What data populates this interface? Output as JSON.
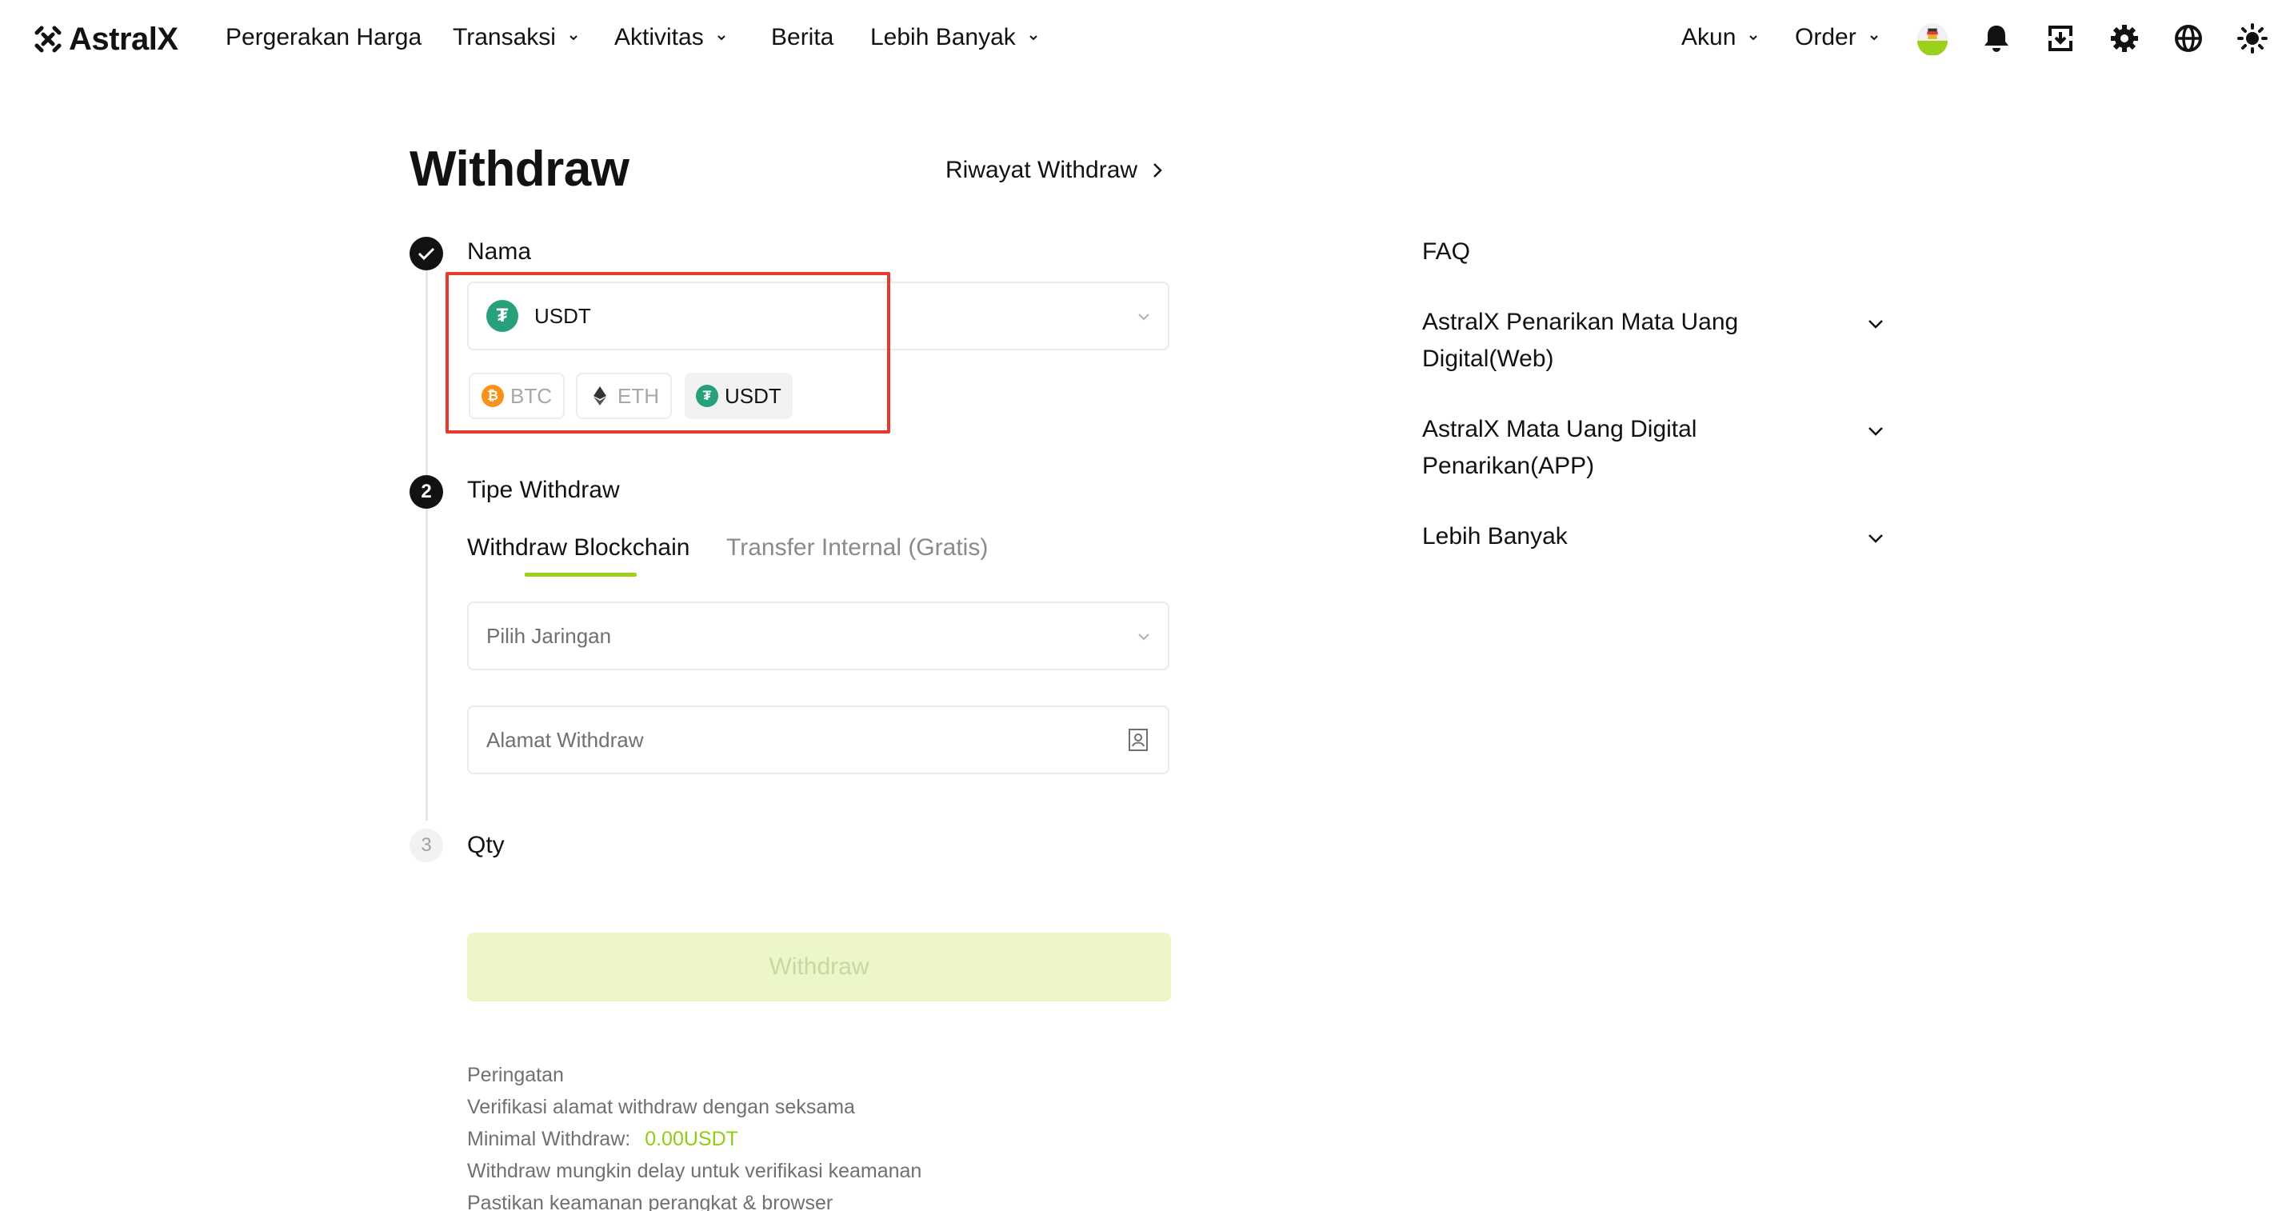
{
  "nav": {
    "logo_text": "AstralX",
    "items": [
      {
        "label": "Pergerakan Harga",
        "has_caret": false
      },
      {
        "label": "Transaksi",
        "has_caret": true
      },
      {
        "label": "Aktivitas",
        "has_caret": true
      },
      {
        "label": "Berita",
        "has_caret": false
      },
      {
        "label": "Lebih Banyak",
        "has_caret": true
      }
    ],
    "right": [
      {
        "label": "Akun",
        "has_caret": true
      },
      {
        "label": "Order",
        "has_caret": true
      }
    ],
    "icons": [
      "avatar-icon",
      "bell-icon",
      "download-app-icon",
      "gear-icon",
      "globe-icon",
      "theme-sun-icon"
    ]
  },
  "page": {
    "title": "Withdraw",
    "history_link": "Riwayat Withdraw"
  },
  "steps": [
    {
      "number": "",
      "label": "Nama",
      "state": "done"
    },
    {
      "number": "2",
      "label": "Tipe Withdraw",
      "state": "active"
    },
    {
      "number": "3",
      "label": "Qty",
      "state": "pending"
    }
  ],
  "coin_select": {
    "value": "USDT",
    "icon": "tether-icon",
    "quick_picks": [
      {
        "label": "BTC",
        "icon": "bitcoin-icon",
        "color": "#f7931a",
        "selected": false
      },
      {
        "label": "ETH",
        "icon": "ethereum-icon",
        "color": "#333333",
        "selected": false
      },
      {
        "label": "USDT",
        "icon": "tether-icon",
        "color": "#26a17b",
        "selected": true
      }
    ]
  },
  "withdraw_type": {
    "tabs": [
      {
        "label": "Withdraw Blockchain",
        "active": true
      },
      {
        "label": "Transfer Internal (Gratis)",
        "active": false
      }
    ],
    "network_placeholder": "Pilih Jaringan",
    "address_placeholder": "Alamat Withdraw"
  },
  "submit": {
    "label": "Withdraw"
  },
  "warnings": {
    "title": "Peringatan",
    "line1": "Verifikasi alamat withdraw dengan seksama",
    "min_label": "Minimal Withdraw:",
    "min_value": "0.00USDT",
    "line3": "Withdraw mungkin delay untuk verifikasi keamanan",
    "line4": "Pastikan keamanan perangkat & browser"
  },
  "faq": {
    "title": "FAQ",
    "items": [
      "AstralX Penarikan Mata Uang Digital(Web)",
      "AstralX Mata Uang Digital Penarikan(APP)",
      "Lebih Banyak"
    ]
  },
  "colors": {
    "accent": "#9bd11a",
    "highlight_border": "#e53a2f",
    "tether": "#26a17b",
    "bitcoin": "#f7931a",
    "button_disabled_bg": "#ecf6c7"
  }
}
